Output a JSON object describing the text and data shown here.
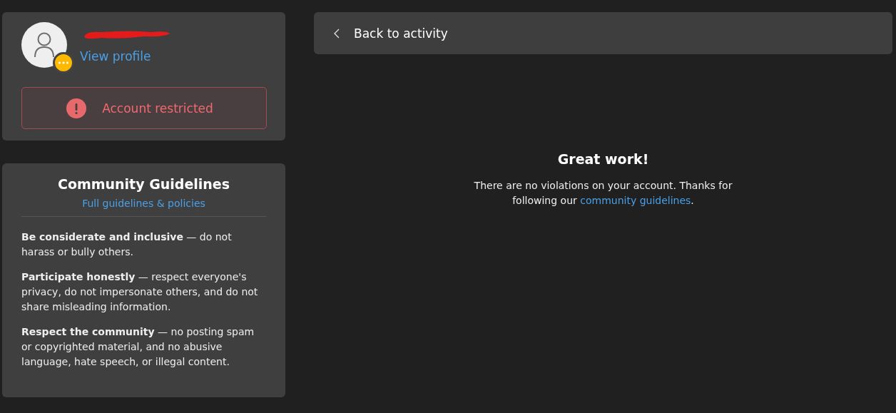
{
  "profile": {
    "link": "View profile",
    "status": {
      "label": "Account restricted"
    }
  },
  "guidelines": {
    "title": "Community Guidelines",
    "link": "Full guidelines & policies",
    "items": [
      "**Be considerate and inclusive** — do not harass or bully others.",
      "**Participate honestly** — respect everyone's privacy, do not impersonate others, and do not share misleading information.",
      "**Respect the community** — no posting spam or copyrighted material, and no abusive language, hate speech, or illegal content."
    ]
  },
  "back": {
    "label": "Back to activity"
  },
  "message": {
    "title": "Great work!",
    "text_before": "There are no violations on your account. Thanks for following our",
    "link": "community guidelines",
    "text_after": "."
  }
}
